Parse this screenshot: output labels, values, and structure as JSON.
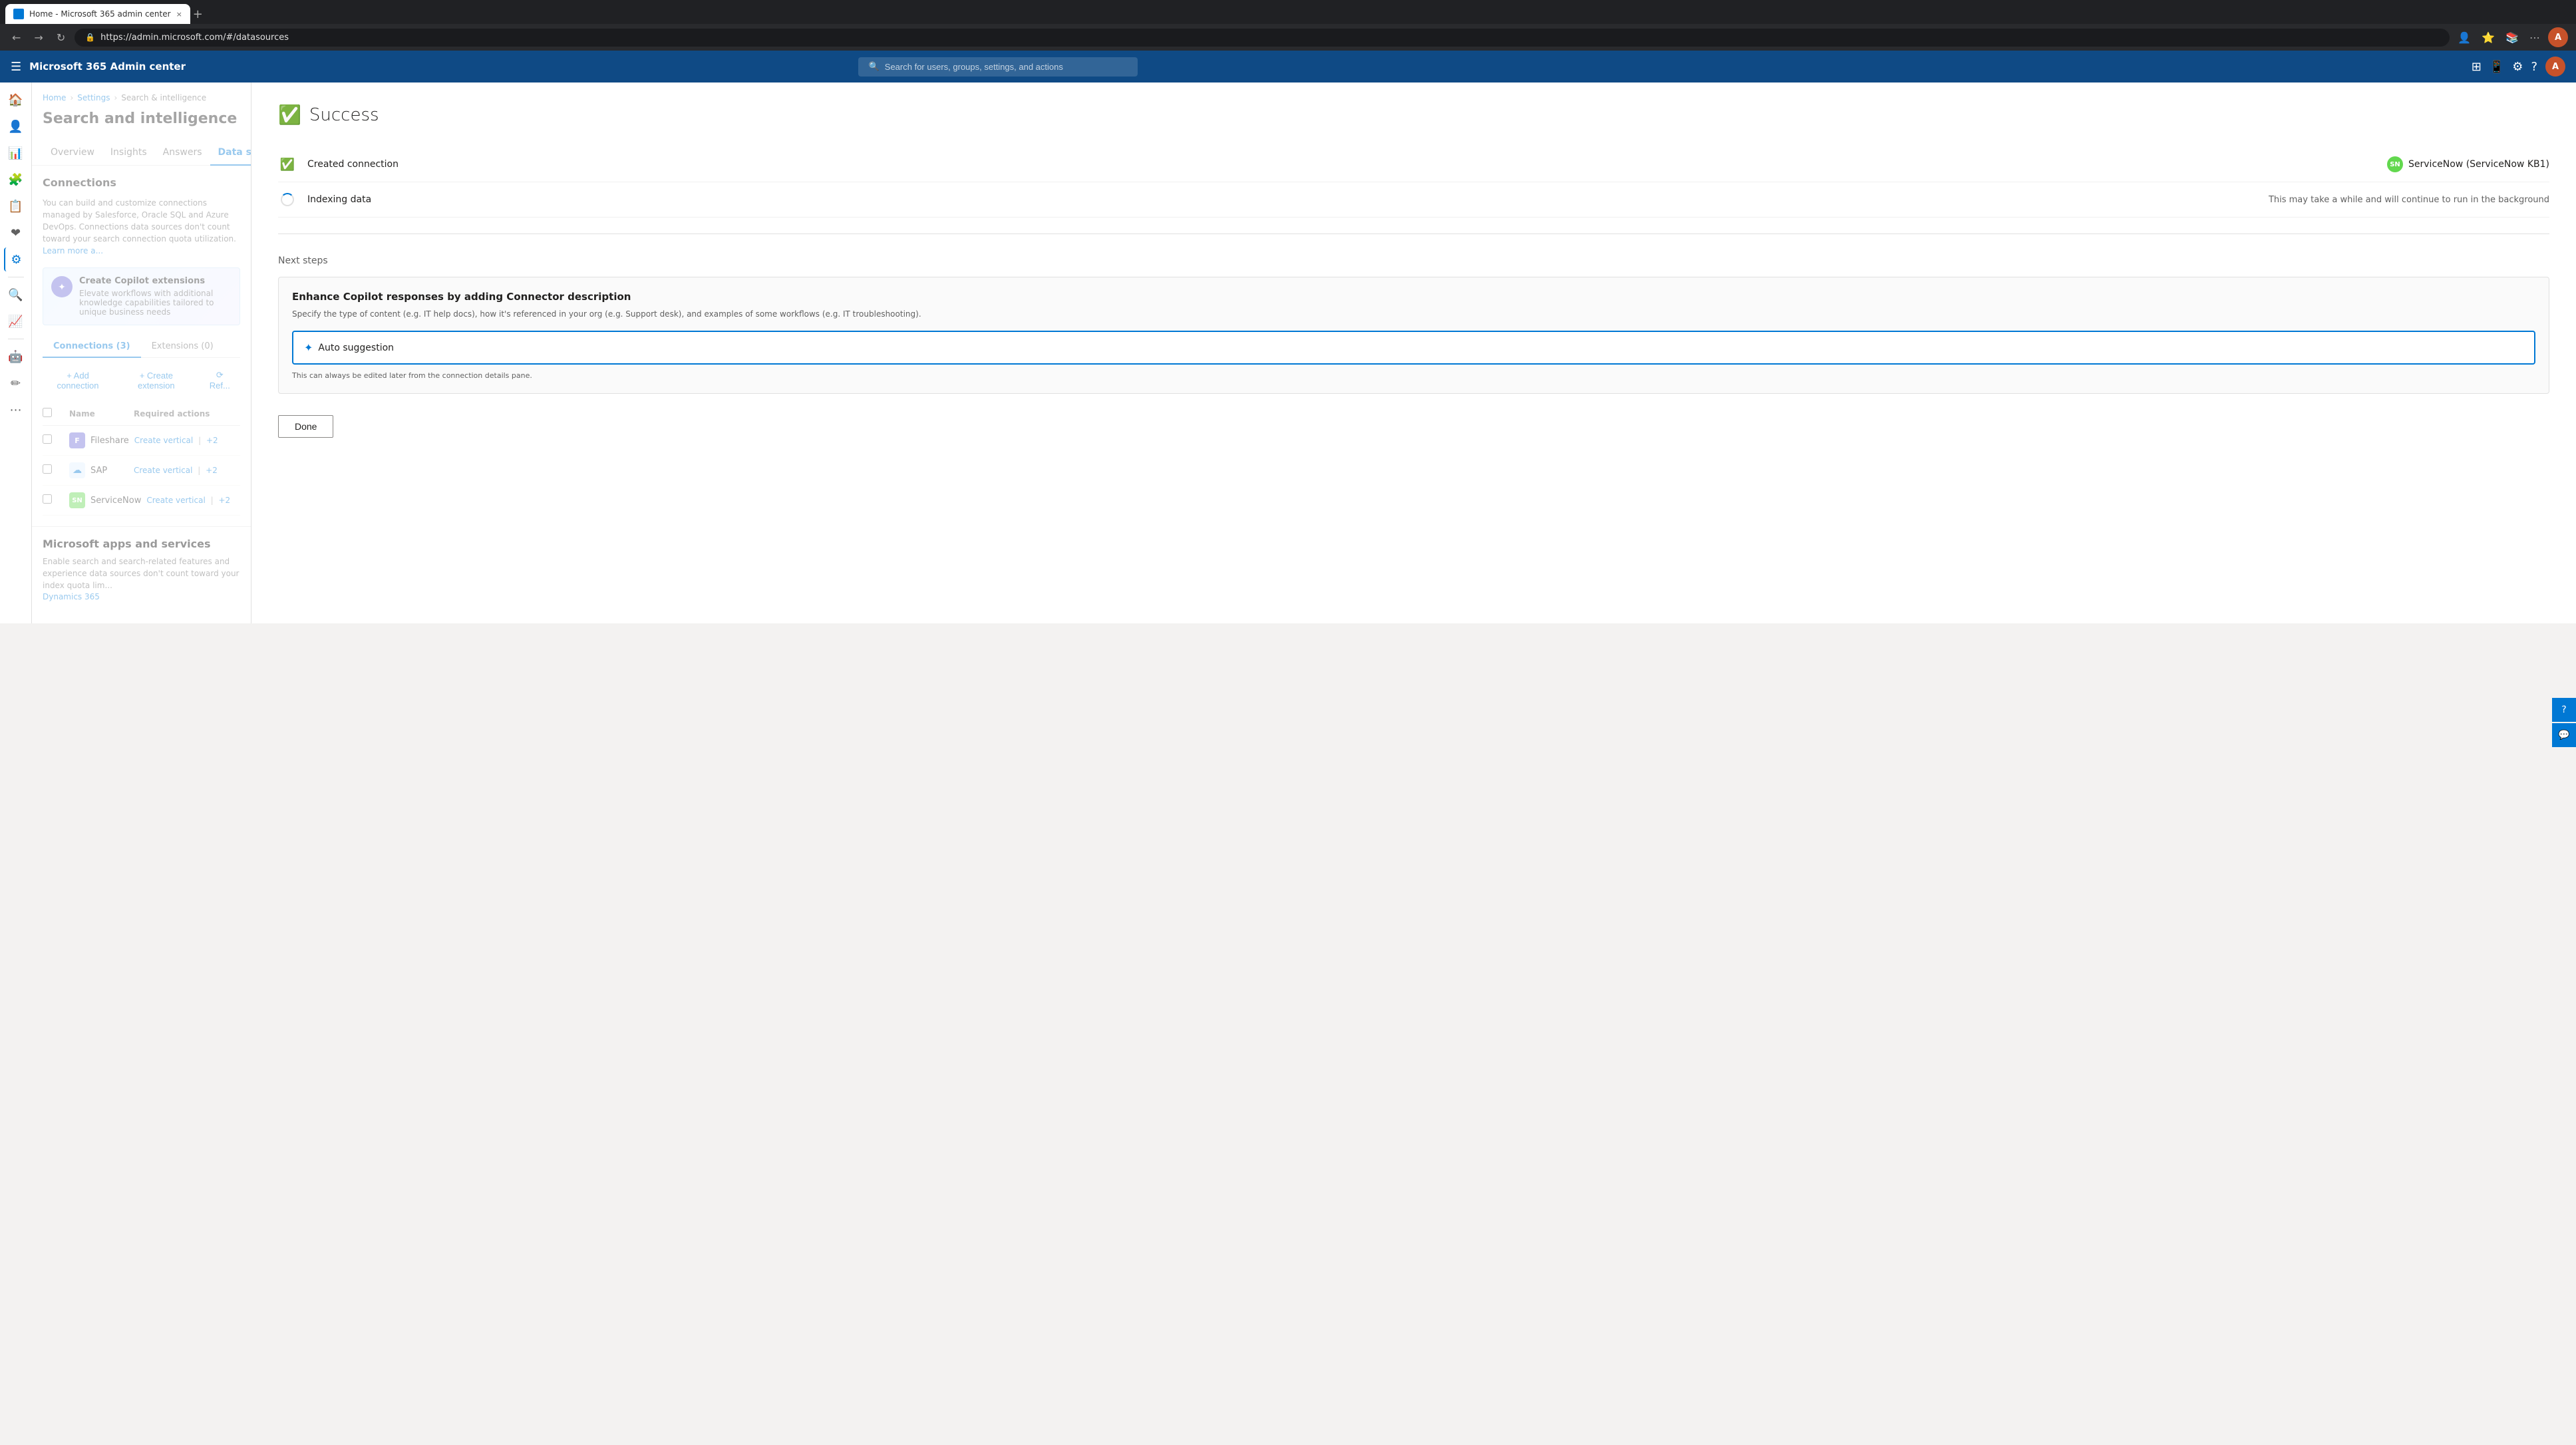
{
  "browser": {
    "tab_title": "Home - Microsoft 365 admin center",
    "tab_close": "×",
    "new_tab": "+",
    "url": "https://admin.microsoft.com/#/datasources",
    "nav_back": "←",
    "nav_forward": "→",
    "nav_refresh": "↻"
  },
  "topbar": {
    "app_name": "Microsoft 365 Admin center",
    "search_placeholder": "Search for users, groups, settings, and actions",
    "avatar_initials": "A"
  },
  "breadcrumb": {
    "home": "Home",
    "settings": "Settings",
    "search_intelligence": "Search & intelligence"
  },
  "page": {
    "title": "Search and intelligence"
  },
  "nav_tabs": [
    {
      "label": "Overview",
      "active": false
    },
    {
      "label": "Insights",
      "active": false
    },
    {
      "label": "Answers",
      "active": false
    },
    {
      "label": "Data sources",
      "active": true
    }
  ],
  "connections": {
    "section_title": "Connections",
    "section_desc": "You can build and customize connections managed by Salesforce, Oracle SQL and Azure DevOps. Connections data sources don't count toward your search connection quota utilization.",
    "learn_more": "Learn more a...",
    "banner": {
      "title": "Create Copilot extensions",
      "desc": "Elevate workflows with additional knowledge capabilities tailored to unique business needs"
    },
    "sub_tabs": [
      {
        "label": "Connections (3)",
        "active": true
      },
      {
        "label": "Extensions (0)",
        "active": false
      }
    ],
    "actions": {
      "add_connection": "+ Add connection",
      "create_extension": "+ Create extension",
      "refresh": "⟳ Ref..."
    },
    "table": {
      "col_name": "Name",
      "col_required_actions": "Required actions",
      "rows": [
        {
          "name": "Fileshare",
          "icon_color": "#6b69d6",
          "icon_text": "F",
          "action_primary": "Create vertical",
          "action_secondary": "+2"
        },
        {
          "name": "SAP",
          "icon_color": "#0070c0",
          "icon_text": "☁",
          "action_primary": "Create vertical",
          "action_secondary": "+2"
        },
        {
          "name": "ServiceNow",
          "icon_color": "#62d84e",
          "icon_text": "SN",
          "action_primary": "Create vertical",
          "action_secondary": "+2"
        }
      ]
    }
  },
  "ms_apps": {
    "section_title": "Microsoft apps and services",
    "desc": "Enable search and search-related features and experience data sources don't count toward your index quota lim...",
    "link": "Dynamics 365"
  },
  "modal": {
    "success_title": "Success",
    "steps": [
      {
        "type": "check",
        "label": "Created connection",
        "value": "ServiceNow (ServiceNow KB1)",
        "has_icon": true
      },
      {
        "type": "spinner",
        "label": "Indexing data",
        "value": "This may take a while and will continue to run in the background",
        "has_icon": false
      }
    ],
    "next_steps": {
      "label": "Next steps",
      "card": {
        "title": "Enhance Copilot responses by adding Connector description",
        "desc": "Specify the type of content (e.g. IT help docs), how it's referenced in your org (e.g. Support desk), and examples of some workflows (e.g. IT troubleshooting).",
        "auto_suggestion_label": "Auto suggestion",
        "edit_note": "This can always be edited later from the connection details pane."
      }
    },
    "done_btn": "Done"
  },
  "float_buttons": [
    "?",
    "💬"
  ],
  "colors": {
    "accent": "#0078d4",
    "success": "#107c10",
    "topbar": "#0f4a85"
  }
}
